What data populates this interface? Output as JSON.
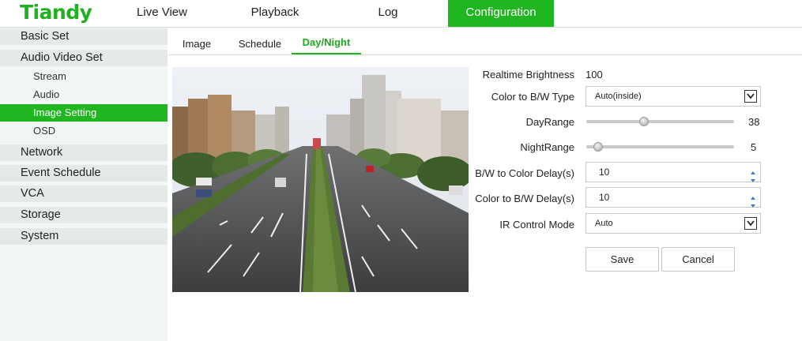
{
  "brand": {
    "logo": "Tiandy",
    "accent": "#1fb61f"
  },
  "topnav": {
    "items": [
      {
        "label": "Live View"
      },
      {
        "label": "Playback"
      },
      {
        "label": "Log"
      },
      {
        "label": "Configuration",
        "active": true
      }
    ]
  },
  "sidebar": {
    "basic": "Basic Set",
    "av": "Audio Video Set",
    "stream": "Stream",
    "audio": "Audio",
    "image_setting": "Image Setting",
    "osd": "OSD",
    "network": "Network",
    "event": "Event Schedule",
    "vca": "VCA",
    "storage": "Storage",
    "system": "System"
  },
  "tabs": {
    "image": "Image",
    "schedule": "Schedule",
    "daynight": "Day/Night",
    "active": "Day/Night"
  },
  "form": {
    "realtime_brightness": {
      "label": "Realtime Brightness",
      "value": "100"
    },
    "color_bw_type": {
      "label": "Color to B/W Type",
      "value": "Auto(inside)"
    },
    "day_range": {
      "label": "DayRange",
      "value": "38",
      "fraction": 0.38
    },
    "night_range": {
      "label": "NightRange",
      "value": "5",
      "fraction": 0.05
    },
    "bw_to_color_delay": {
      "label": "B/W to Color Delay(s)",
      "value": "10"
    },
    "color_to_bw_delay": {
      "label": "Color to B/W Delay(s)",
      "value": "10"
    },
    "ir_control_mode": {
      "label": "IR Control Mode",
      "value": "Auto"
    },
    "save": "Save",
    "cancel": "Cancel"
  }
}
